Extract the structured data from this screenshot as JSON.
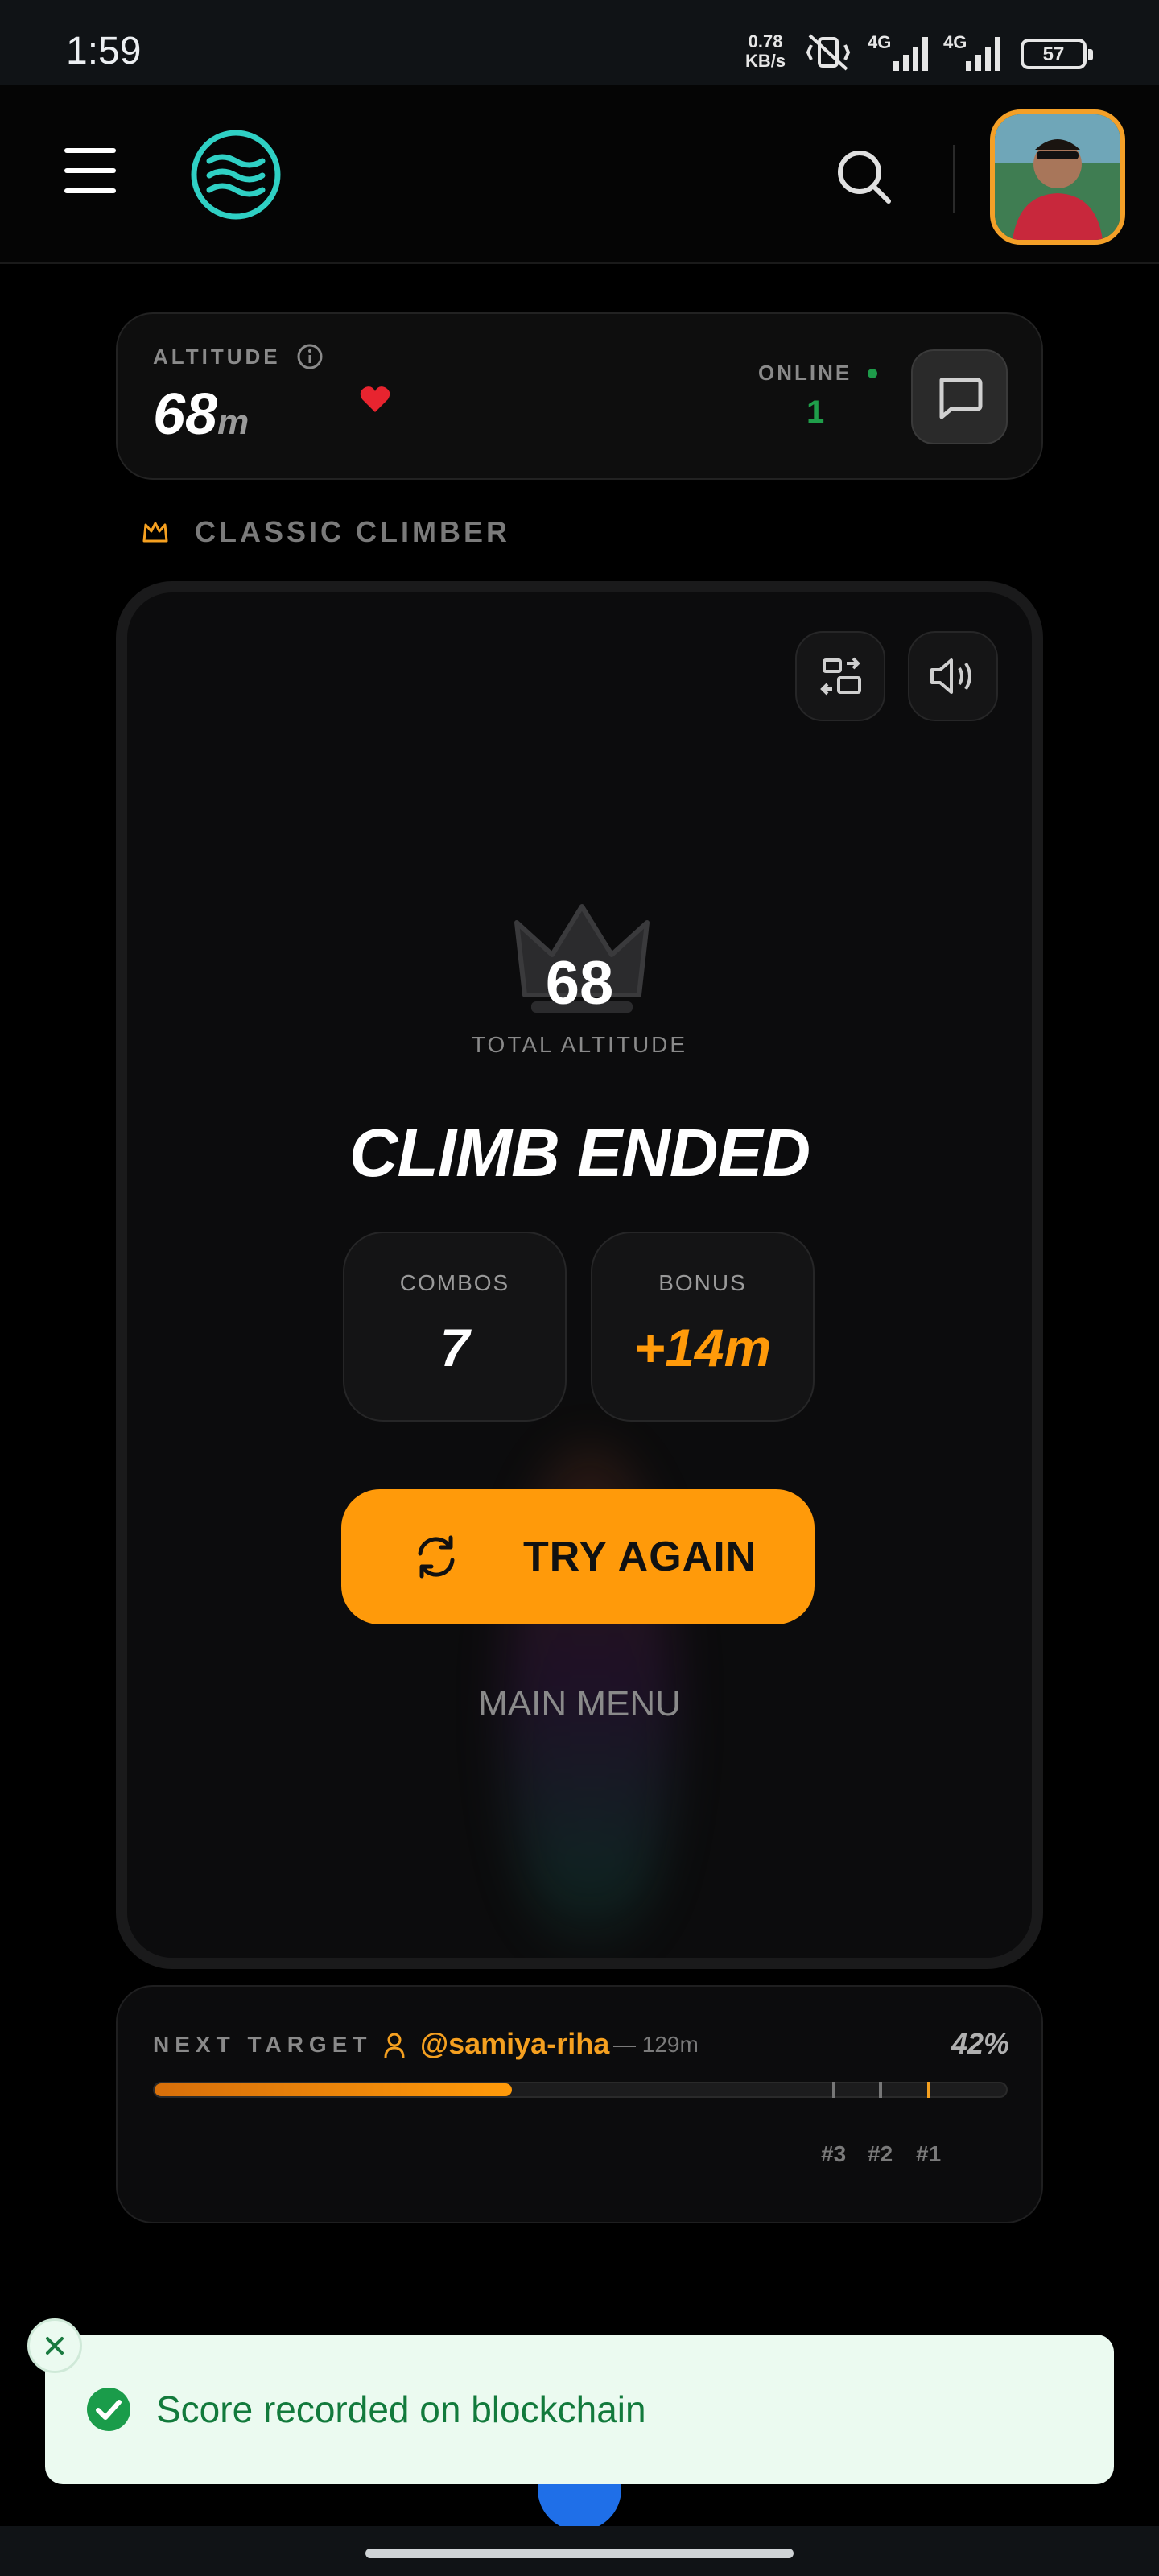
{
  "status_bar": {
    "time": "1:59",
    "speed_value": "0.78",
    "speed_unit": "KB/s",
    "network_1": "4G",
    "network_2": "4G",
    "battery": "57"
  },
  "header": {
    "menu_icon": "hamburger-icon",
    "logo_icon": "waves-logo-icon",
    "search_icon": "search-icon",
    "avatar": "user-avatar"
  },
  "altitude_card": {
    "label": "ALTITUDE",
    "value": "68",
    "unit": "m",
    "online_label": "ONLINE",
    "online_count": "1",
    "chat_icon": "chat-icon"
  },
  "mode": {
    "label": "CLASSIC CLIMBER",
    "icon": "crown-outline-icon"
  },
  "game_panel": {
    "total_value": "68",
    "total_label": "TOTAL ALTITUDE",
    "title": "CLIMB ENDED",
    "stats": [
      {
        "label": "COMBOS",
        "value": "7"
      },
      {
        "label": "BONUS",
        "value": "+14m"
      }
    ],
    "try_again_label": "TRY AGAIN",
    "main_menu_label": "MAIN MENU"
  },
  "next_target": {
    "label": "NEXT TARGET",
    "user": "@samiya-riha",
    "altitude": "— 129m",
    "percent_text": "42%",
    "progress": 0.42,
    "ranks": [
      "#3",
      "#2",
      "#1"
    ]
  },
  "toast": {
    "message": "Score recorded on blockchain"
  },
  "colors": {
    "accent": "#ff9a0a",
    "success": "#1f9e4a",
    "toast_bg": "#ebfaf0"
  }
}
